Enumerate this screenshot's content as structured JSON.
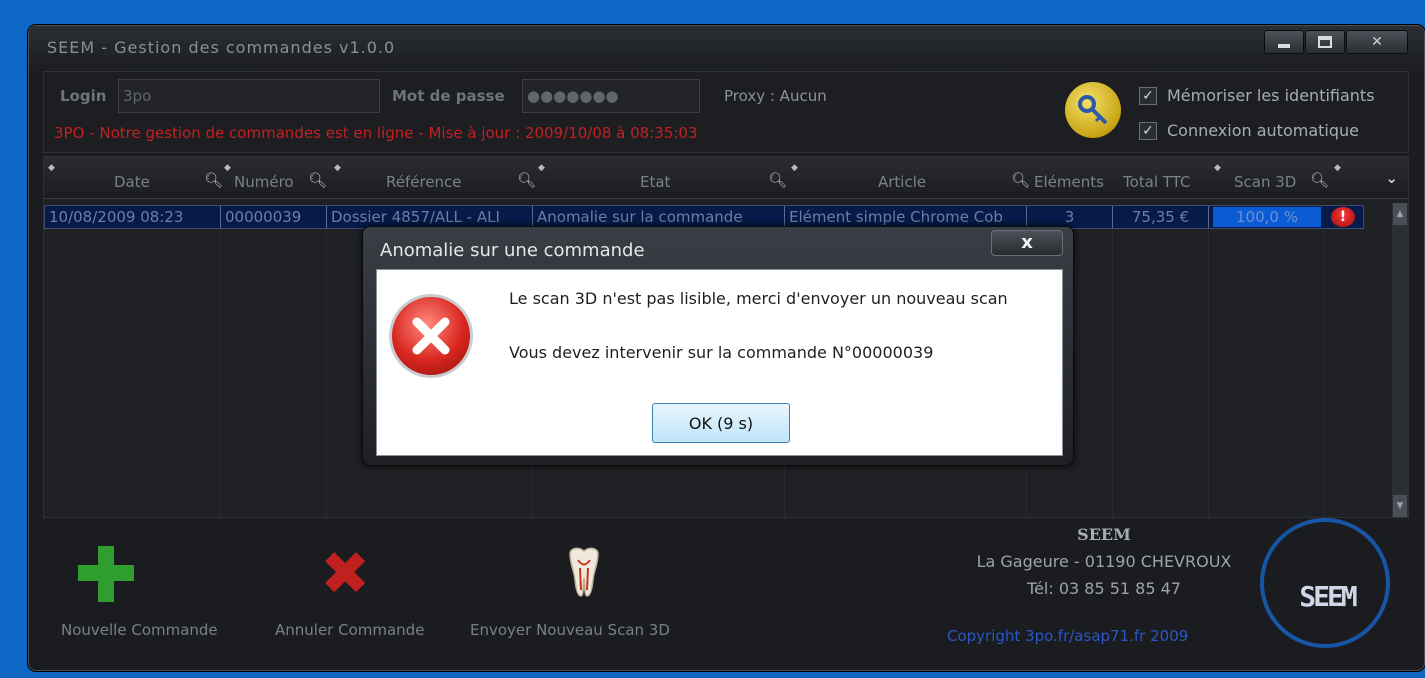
{
  "window": {
    "title": "SEEM - Gestion des commandes v1.0.0"
  },
  "login": {
    "login_label": "Login",
    "login_value": "3po",
    "password_label": "Mot de passe",
    "password_value": "●●●●●●●",
    "proxy_text": "Proxy : Aucun",
    "status_text": "3PO - Notre gestion de commandes est en ligne - Mise à jour : 2009/10/08 à 08:35:03",
    "remember_label": "Mémoriser les identifiants",
    "autoconnect_label": "Connexion automatique"
  },
  "table": {
    "columns": [
      "Date",
      "Numéro",
      "Référence",
      "Etat",
      "Article",
      "Eléments",
      "Total TTC",
      "Scan 3D"
    ],
    "rows": [
      {
        "date": "10/08/2009 08:23",
        "numero": "00000039",
        "reference": "Dossier 4857/ALL - ALI",
        "etat": "Anomalie sur la commande",
        "article": "Elément simple Chrome Cob",
        "elements": "3",
        "total": "75,35 €",
        "scan": "100,0 %",
        "scan_fraction": 1.0,
        "warning": "!"
      }
    ]
  },
  "toolbar": {
    "new_label": "Nouvelle Commande",
    "cancel_label": "Annuler Commande",
    "send_scan_label": "Envoyer Nouveau Scan 3D"
  },
  "company": {
    "name": "SEEM",
    "address": "La Gageure - 01190 CHEVROUX",
    "tel": "Tél: 03 85 51 85 47",
    "copyright": "Copyright 3po.fr/asap71.fr 2009",
    "logo_text": "SEEM"
  },
  "dialog": {
    "title": "Anomalie sur une commande",
    "message1": "Le scan 3D n'est pas lisible, merci d'envoyer un nouveau scan",
    "message2": "Vous devez intervenir sur la commande N°00000039",
    "ok_label": "OK (9 s)",
    "close_label": "x"
  },
  "colors": {
    "background": "#0d67c4",
    "window": "#1a1c1f",
    "status_red": "#c42020",
    "selected_row": "#061b4a",
    "scan_bar": "#0b5bd4",
    "copyright_blue": "#2a57c7"
  },
  "icons": {
    "key": "key-icon",
    "plus": "plus-icon",
    "cross": "cross-icon",
    "tooth": "tooth-icon",
    "error": "error-icon",
    "sort": "sort-arrow-icon",
    "magnifier": "magnifier-icon",
    "expand": "expand-chevron-icon"
  }
}
